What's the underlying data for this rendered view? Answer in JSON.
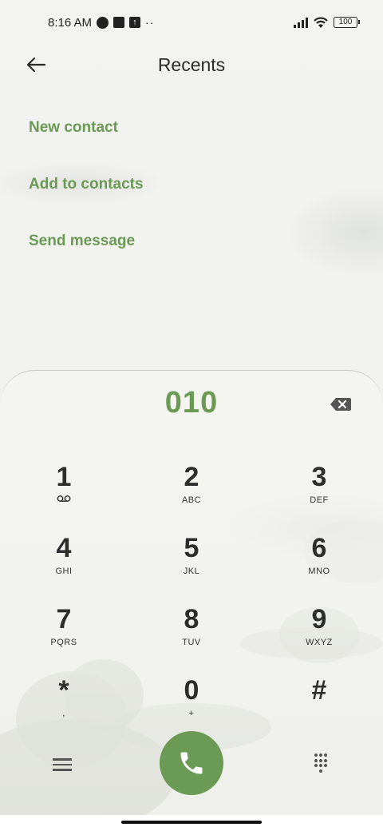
{
  "status": {
    "time": "8:16 AM",
    "dots": "··",
    "battery": "100"
  },
  "header": {
    "title": "Recents",
    "back_icon": "arrow-left-icon"
  },
  "options": [
    {
      "label": "New contact"
    },
    {
      "label": "Add to contacts"
    },
    {
      "label": "Send message"
    }
  ],
  "dialer": {
    "number": "010",
    "keys": [
      {
        "digit": "1",
        "letters": ""
      },
      {
        "digit": "2",
        "letters": "ABC"
      },
      {
        "digit": "3",
        "letters": "DEF"
      },
      {
        "digit": "4",
        "letters": "GHI"
      },
      {
        "digit": "5",
        "letters": "JKL"
      },
      {
        "digit": "6",
        "letters": "MNO"
      },
      {
        "digit": "7",
        "letters": "PQRS"
      },
      {
        "digit": "8",
        "letters": "TUV"
      },
      {
        "digit": "9",
        "letters": "WXYZ"
      },
      {
        "digit": "*",
        "letters": ","
      },
      {
        "digit": "0",
        "letters": "+"
      },
      {
        "digit": "#",
        "letters": ""
      }
    ]
  },
  "colors": {
    "accent": "#6a9a53",
    "text": "#2d2d2d",
    "background": "#f2f2f0"
  }
}
